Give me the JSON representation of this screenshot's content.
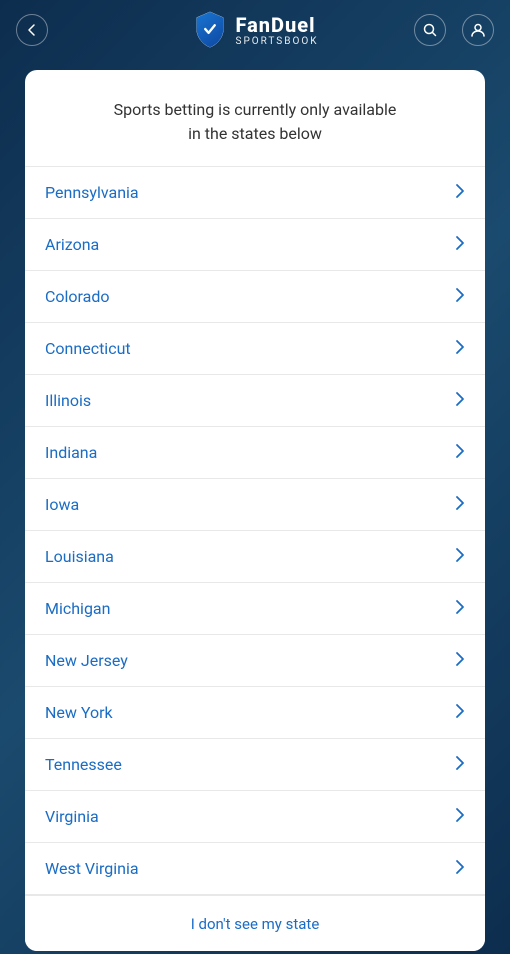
{
  "header": {
    "logo": {
      "name": "FanDuel",
      "subtitle": "SPORTSBOOK"
    },
    "back_icon": "←",
    "search_icon": "🔍",
    "user_icon": "👤"
  },
  "modal": {
    "title_line1": "Sports betting is currently only available",
    "title_line2": "in the states below",
    "states": [
      {
        "name": "Pennsylvania"
      },
      {
        "name": "Arizona"
      },
      {
        "name": "Colorado"
      },
      {
        "name": "Connecticut"
      },
      {
        "name": "Illinois"
      },
      {
        "name": "Indiana"
      },
      {
        "name": "Iowa"
      },
      {
        "name": "Louisiana"
      },
      {
        "name": "Michigan"
      },
      {
        "name": "New Jersey"
      },
      {
        "name": "New York"
      },
      {
        "name": "Tennessee"
      },
      {
        "name": "Virginia"
      },
      {
        "name": "West Virginia"
      }
    ],
    "footer_link": "I don't see my state"
  }
}
